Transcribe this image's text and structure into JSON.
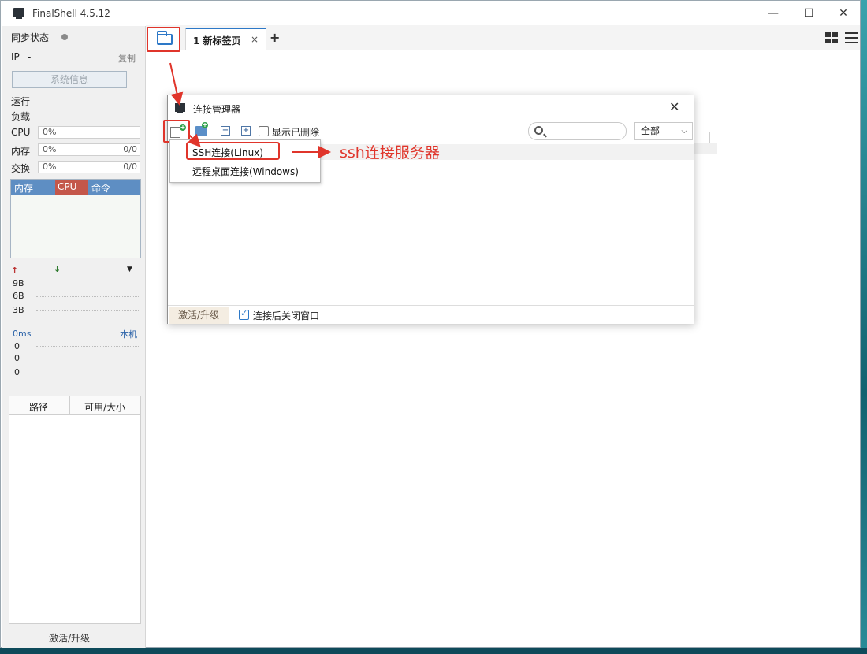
{
  "window": {
    "title": "FinalShell 4.5.12",
    "minimize": "—",
    "maximize": "☐",
    "close": "✕"
  },
  "sidebar": {
    "sync_label": "同步状态",
    "ip_label": "IP",
    "ip_value": "-",
    "copy": "复制",
    "sys_info": "系统信息",
    "run_label": "运行 -",
    "load_label": "负载 -",
    "cpu_label": "CPU",
    "cpu_value": "0%",
    "mem_label": "内存",
    "mem_value": "0%",
    "mem_size": "0/0",
    "swap_label": "交换",
    "swap_value": "0%",
    "swap_size": "0/0",
    "proc_cols": [
      "内存",
      "CPU",
      "命令"
    ],
    "net_levels": [
      "9B",
      "6B",
      "3B"
    ],
    "latency": "0ms",
    "latency_host": "本机",
    "latency_vals": [
      "0",
      "0",
      "0"
    ],
    "disk_cols": [
      "路径",
      "可用/大小"
    ],
    "activate": "激活/升级",
    "up_arrow": "↑",
    "down_arrow": "↓",
    "dropdown": "▼"
  },
  "tabs": {
    "active_label": "1 新标签页",
    "close": "×",
    "add": "+"
  },
  "dialog": {
    "title": "连接管理器",
    "close": "✕",
    "show_deleted": "显示已删除",
    "minus": "−",
    "plus": "+",
    "filter_value": "全部",
    "chevron": "⌵",
    "activate": "激活/升级",
    "close_after_connect": "连接后关闭窗口"
  },
  "menu": {
    "items": [
      "SSH连接(Linux)",
      "远程桌面连接(Windows)"
    ]
  },
  "annotation": {
    "text": "ssh连接服务器"
  },
  "colors": {
    "accent": "#2d78c7",
    "highlight": "#e0352b"
  }
}
